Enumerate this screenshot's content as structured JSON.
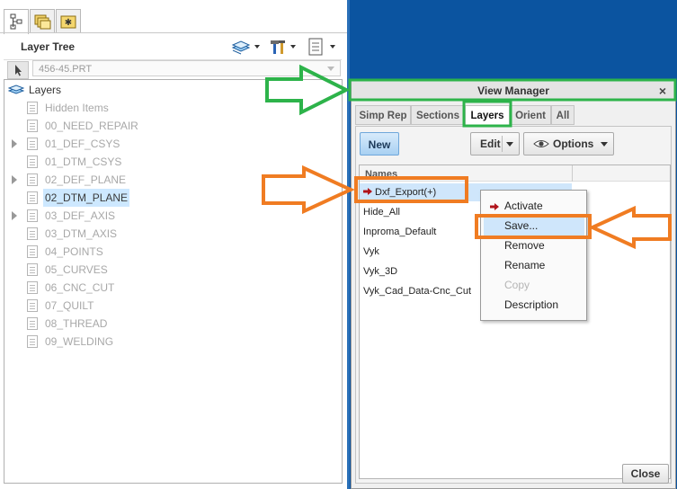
{
  "layer_tree": {
    "title": "Layer Tree",
    "model_selector": "456-45.PRT",
    "root_label": "Layers",
    "layers": [
      {
        "label": "Hidden Items",
        "expandable": false,
        "selected": false
      },
      {
        "label": "00_NEED_REPAIR",
        "expandable": false,
        "selected": false
      },
      {
        "label": "01_DEF_CSYS",
        "expandable": true,
        "selected": false
      },
      {
        "label": "01_DTM_CSYS",
        "expandable": false,
        "selected": false
      },
      {
        "label": "02_DEF_PLANE",
        "expandable": true,
        "selected": false
      },
      {
        "label": "02_DTM_PLANE",
        "expandable": false,
        "selected": true
      },
      {
        "label": "03_DEF_AXIS",
        "expandable": true,
        "selected": false
      },
      {
        "label": "03_DTM_AXIS",
        "expandable": false,
        "selected": false
      },
      {
        "label": "04_POINTS",
        "expandable": false,
        "selected": false
      },
      {
        "label": "05_CURVES",
        "expandable": false,
        "selected": false
      },
      {
        "label": "06_CNC_CUT",
        "expandable": false,
        "selected": false
      },
      {
        "label": "07_QUILT",
        "expandable": false,
        "selected": false
      },
      {
        "label": "08_THREAD",
        "expandable": false,
        "selected": false
      },
      {
        "label": "09_WELDING",
        "expandable": false,
        "selected": false
      }
    ],
    "icons": {
      "tab1": "model-tree-icon",
      "tab2": "folder-browser-icon",
      "tab3": "favorites-folder-icon",
      "toolbar": [
        "layers-stack-icon",
        "tools-icon",
        "list-settings-icon"
      ]
    }
  },
  "view_manager": {
    "title": "View Manager",
    "close_glyph": "×",
    "tabs": [
      "Simp Rep",
      "Sections",
      "Layers",
      "Orient",
      "All"
    ],
    "active_tab": "Layers",
    "buttons": {
      "new": "New",
      "edit": "Edit",
      "options": "Options",
      "close": "Close"
    },
    "names_header": "Names",
    "names": [
      "Dxf_Export(+)",
      "Hide_All",
      "Inproma_Default",
      "Vyk",
      "Vyk_3D",
      "Vyk_Cad_Data-Cnc_Cut"
    ],
    "selected_name": "Dxf_Export(+)"
  },
  "context_menu": {
    "items": [
      "Activate",
      "Save...",
      "Remove",
      "Rename",
      "Copy",
      "Description"
    ],
    "hovered": "Save...",
    "disabled": [
      "Copy"
    ]
  },
  "colors": {
    "annotation_green": "#2db34a",
    "annotation_orange": "#f07c22",
    "desktop_blue": "#0b54a0",
    "selection_blue": "#cde8ff",
    "active_arrow_red": "#b0141b"
  }
}
